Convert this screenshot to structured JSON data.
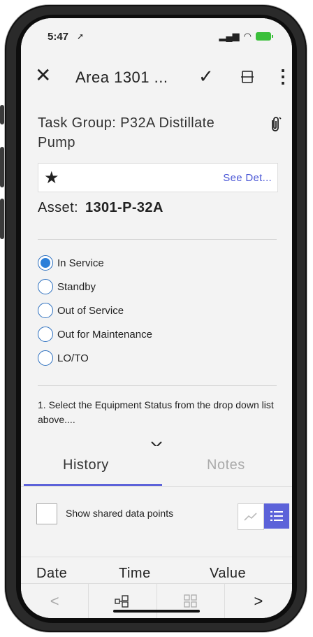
{
  "status": {
    "time": "5:47",
    "location_icon": "location-arrow-icon",
    "signal_icon": "signal-icon",
    "wifi_icon": "wifi-icon",
    "battery_icon": "battery-charging-icon",
    "battery_color": "#3bbf3b"
  },
  "appbar": {
    "close_label": "✕",
    "title": "Area 1301 ...",
    "check_label": "✓",
    "more_label": "⋮"
  },
  "task": {
    "title": "Task Group: P32A Distillate Pump",
    "star": "★",
    "see_details": "See Det...",
    "asset_label": "Asset:",
    "asset_value": "1301-P-32A"
  },
  "statuses": [
    {
      "label": "In Service",
      "selected": true
    },
    {
      "label": "Standby",
      "selected": false
    },
    {
      "label": "Out of Service",
      "selected": false
    },
    {
      "label": "Out for Maintenance",
      "selected": false
    },
    {
      "label": "LO/TO",
      "selected": false
    }
  ],
  "instruction": "1. Select the Equipment Status from the drop down list above....",
  "tabs": {
    "history": "History",
    "notes": "Notes"
  },
  "shared": {
    "label": "Show shared data points"
  },
  "table": {
    "date": "Date",
    "time": "Time",
    "value": "Value"
  },
  "bottom": {
    "prev": "<",
    "next": ">"
  },
  "colors": {
    "accent": "#5c62d9",
    "link": "#4a56d6",
    "radio": "#2b7fd9"
  }
}
